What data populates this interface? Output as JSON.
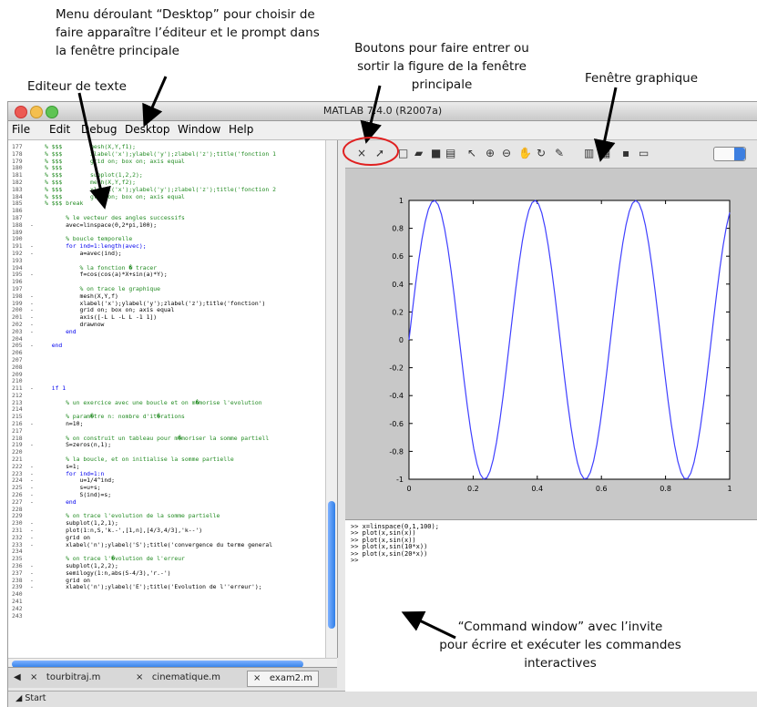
{
  "annotations": {
    "desktop_menu": [
      "Menu déroulant “Desktop” pour choisir de",
      "faire apparaître l’éditeur et le prompt dans",
      "la fenêtre principale"
    ],
    "buttons": [
      "Boutons pour faire entrer ou",
      "sortir la figure de la fenêtre",
      "principale"
    ],
    "editor": "Editeur de texte",
    "graphic": "Fenêtre graphique",
    "command": [
      "“Command window” avec l’invite",
      "pour écrire et exécuter les commandes",
      "interactives"
    ]
  },
  "window": {
    "title": "MATLAB 7.4.0 (R2007a)",
    "menus": [
      "File",
      "Edit",
      "Debug",
      "Desktop",
      "Window",
      "Help"
    ]
  },
  "editor_lines": [
    {
      "n": "177",
      "d": "",
      "t": "% $$$        mesh(X,Y,f1);",
      "c": "cm"
    },
    {
      "n": "178",
      "d": "",
      "t": "% $$$        xlabel('x');ylabel('y');zlabel('z');title('fonction 1",
      "c": "cm"
    },
    {
      "n": "179",
      "d": "",
      "t": "% $$$        grid on; box on; axis equal",
      "c": "cm"
    },
    {
      "n": "180",
      "d": "",
      "t": "% $$$",
      "c": "cm"
    },
    {
      "n": "181",
      "d": "",
      "t": "% $$$        subplot(1,2,2);",
      "c": "cm"
    },
    {
      "n": "182",
      "d": "",
      "t": "% $$$        mesh(X,Y,f2);",
      "c": "cm"
    },
    {
      "n": "183",
      "d": "",
      "t": "% $$$        xlabel('x');ylabel('y');zlabel('z');title('fonction 2",
      "c": "cm"
    },
    {
      "n": "184",
      "d": "",
      "t": "% $$$        grid on; box on; axis equal",
      "c": "cm"
    },
    {
      "n": "185",
      "d": "",
      "t": "% $$$ break",
      "c": "cm"
    },
    {
      "n": "186",
      "d": "",
      "t": "",
      "c": ""
    },
    {
      "n": "187",
      "d": "",
      "t": "      % le vecteur des angles successifs",
      "c": "cm"
    },
    {
      "n": "188",
      "d": "-",
      "t": "      avec=linspace(0,2*pi,100);",
      "c": ""
    },
    {
      "n": "189",
      "d": "",
      "t": "",
      "c": ""
    },
    {
      "n": "190",
      "d": "",
      "t": "      % boucle temporelle",
      "c": "cm"
    },
    {
      "n": "191",
      "d": "-",
      "t": "      for ind=1:length(avec);",
      "c": "kw"
    },
    {
      "n": "192",
      "d": "-",
      "t": "          a=avec(ind);",
      "c": ""
    },
    {
      "n": "193",
      "d": "",
      "t": "",
      "c": ""
    },
    {
      "n": "194",
      "d": "",
      "t": "          % la fonction � tracer",
      "c": "cm"
    },
    {
      "n": "195",
      "d": "-",
      "t": "          f=cos(cos(a)*X+sin(a)*Y);",
      "c": ""
    },
    {
      "n": "196",
      "d": "",
      "t": "",
      "c": ""
    },
    {
      "n": "197",
      "d": "",
      "t": "          % on trace le graphique",
      "c": "cm"
    },
    {
      "n": "198",
      "d": "-",
      "t": "          mesh(X,Y,f)",
      "c": ""
    },
    {
      "n": "199",
      "d": "-",
      "t": "          xlabel('x');ylabel('y');zlabel('z');title('fonction')",
      "c": ""
    },
    {
      "n": "200",
      "d": "-",
      "t": "          grid on; box on; axis equal",
      "c": ""
    },
    {
      "n": "201",
      "d": "-",
      "t": "          axis([-L L -L L -1 1])",
      "c": ""
    },
    {
      "n": "202",
      "d": "-",
      "t": "          drawnow",
      "c": ""
    },
    {
      "n": "203",
      "d": "-",
      "t": "      end",
      "c": "kw"
    },
    {
      "n": "204",
      "d": "",
      "t": "",
      "c": ""
    },
    {
      "n": "205",
      "d": "-",
      "t": "  end",
      "c": "kw"
    },
    {
      "n": "206",
      "d": "",
      "t": "",
      "c": ""
    },
    {
      "n": "207",
      "d": "",
      "t": "",
      "c": ""
    },
    {
      "n": "208",
      "d": "",
      "t": "",
      "c": ""
    },
    {
      "n": "209",
      "d": "",
      "t": "",
      "c": ""
    },
    {
      "n": "210",
      "d": "",
      "t": "",
      "c": ""
    },
    {
      "n": "211",
      "d": "-",
      "t": "  if 1",
      "c": "kw"
    },
    {
      "n": "212",
      "d": "",
      "t": "",
      "c": ""
    },
    {
      "n": "213",
      "d": "",
      "t": "      % un exercice avec une boucle et on m�morise l'evolution",
      "c": "cm"
    },
    {
      "n": "214",
      "d": "",
      "t": "",
      "c": ""
    },
    {
      "n": "215",
      "d": "",
      "t": "      % param�tre n: nombre d'it�rations",
      "c": "cm"
    },
    {
      "n": "216",
      "d": "-",
      "t": "      n=10;",
      "c": ""
    },
    {
      "n": "217",
      "d": "",
      "t": "",
      "c": ""
    },
    {
      "n": "218",
      "d": "",
      "t": "      % on construit un tableau pour m�moriser la somme partiell",
      "c": "cm"
    },
    {
      "n": "219",
      "d": "-",
      "t": "      S=zeros(n,1);",
      "c": ""
    },
    {
      "n": "220",
      "d": "",
      "t": "",
      "c": ""
    },
    {
      "n": "221",
      "d": "",
      "t": "      % la boucle, et on initialise la somme partielle",
      "c": "cm"
    },
    {
      "n": "222",
      "d": "-",
      "t": "      s=1;",
      "c": ""
    },
    {
      "n": "223",
      "d": "-",
      "t": "      for ind=1:n",
      "c": "kw"
    },
    {
      "n": "224",
      "d": "-",
      "t": "          u=1/4^ind;",
      "c": ""
    },
    {
      "n": "225",
      "d": "-",
      "t": "          s=u+s;",
      "c": ""
    },
    {
      "n": "226",
      "d": "-",
      "t": "          S(ind)=s;",
      "c": ""
    },
    {
      "n": "227",
      "d": "-",
      "t": "      end",
      "c": "kw"
    },
    {
      "n": "228",
      "d": "",
      "t": "",
      "c": ""
    },
    {
      "n": "229",
      "d": "",
      "t": "      % on trace l'evolution de la somme partielle",
      "c": "cm"
    },
    {
      "n": "230",
      "d": "-",
      "t": "      subplot(1,2,1);",
      "c": ""
    },
    {
      "n": "231",
      "d": "-",
      "t": "      plot(1:n,S,'k.-',[1,n],[4/3,4/3],'k--')",
      "c": ""
    },
    {
      "n": "232",
      "d": "-",
      "t": "      grid on",
      "c": ""
    },
    {
      "n": "233",
      "d": "-",
      "t": "      xlabel('n');ylabel('S');title('convergence du terme general",
      "c": ""
    },
    {
      "n": "234",
      "d": "",
      "t": "",
      "c": ""
    },
    {
      "n": "235",
      "d": "",
      "t": "      % on trace l'�volution de l'erreur",
      "c": "cm"
    },
    {
      "n": "236",
      "d": "-",
      "t": "      subplot(1,2,2);",
      "c": ""
    },
    {
      "n": "237",
      "d": "-",
      "t": "      semilogy(1:n,abs(S-4/3),'r.-')",
      "c": ""
    },
    {
      "n": "238",
      "d": "-",
      "t": "      grid on",
      "c": ""
    },
    {
      "n": "239",
      "d": "-",
      "t": "      xlabel('n');ylabel('E');title('Evolution de l''erreur');",
      "c": ""
    },
    {
      "n": "240",
      "d": "",
      "t": "",
      "c": ""
    },
    {
      "n": "241",
      "d": "",
      "t": "",
      "c": ""
    },
    {
      "n": "242",
      "d": "",
      "t": "",
      "c": ""
    },
    {
      "n": "243",
      "d": "",
      "t": "",
      "c": ""
    }
  ],
  "tabs": [
    {
      "label": "tourbitraj.m",
      "active": false
    },
    {
      "label": "cinematique.m",
      "active": false
    },
    {
      "label": "exam2.m",
      "active": true
    }
  ],
  "status": {
    "start": "Start"
  },
  "command_lines": [
    ">> x=linspace(0,1,100);",
    ">> plot(x,sin(x))",
    ">> plot(x,sin(x))",
    ">> plot(x,sin(10*x))",
    ">> plot(x,sin(20*x))",
    ">>"
  ],
  "chart_data": {
    "type": "line",
    "series": [
      {
        "function": "sin(20*x)",
        "x_start": 0,
        "x_end": 1,
        "points": 100,
        "color": "#3f3fff"
      }
    ],
    "xlim": [
      0,
      1
    ],
    "ylim": [
      -1,
      1
    ],
    "xticks": [
      "0",
      "0.2",
      "0.4",
      "0.6",
      "0.8",
      "1"
    ],
    "yticks": [
      "-1",
      "-0.8",
      "-0.6",
      "-0.4",
      "-0.2",
      "0",
      "0.2",
      "0.4",
      "0.6",
      "0.8",
      "1"
    ],
    "grid": false
  },
  "colors": {
    "annotation_circle": "#e02020",
    "plot_line": "#3f3fff",
    "comment": "#228b22",
    "keyword": "#0000ee"
  }
}
